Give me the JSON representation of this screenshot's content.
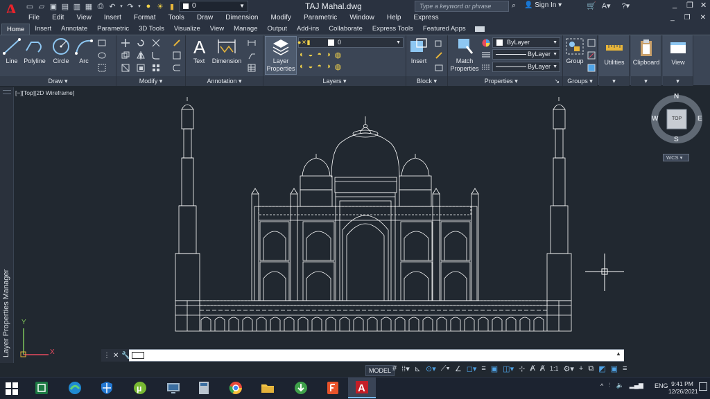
{
  "window": {
    "title": "TAJ Mahal.dwg",
    "search_placeholder": "Type a keyword or phrase",
    "sign_in": "Sign In",
    "qat_layer": "0",
    "controls": [
      "_",
      "❐",
      "✕"
    ]
  },
  "menubar": {
    "items": [
      "File",
      "Edit",
      "View",
      "Insert",
      "Format",
      "Tools",
      "Draw",
      "Dimension",
      "Modify",
      "Parametric",
      "Window",
      "Help",
      "Express"
    ]
  },
  "ribbon": {
    "tabs": [
      "Home",
      "Insert",
      "Annotate",
      "Parametric",
      "3D Tools",
      "Visualize",
      "View",
      "Manage",
      "Output",
      "Add-ins",
      "Collaborate",
      "Express Tools",
      "Featured Apps"
    ],
    "active_tab": "Home",
    "draw": {
      "title": "Draw",
      "line": "Line",
      "polyline": "Polyline",
      "circle": "Circle",
      "arc": "Arc"
    },
    "modify": {
      "title": "Modify"
    },
    "annotation": {
      "title": "Annotation",
      "text": "Text",
      "dimension": "Dimension"
    },
    "layers": {
      "title": "Layers",
      "layer_properties_1": "Layer",
      "layer_properties_2": "Properties",
      "current_layer": "0"
    },
    "block": {
      "title": "Block",
      "insert": "Insert"
    },
    "properties": {
      "title": "Properties",
      "match_1": "Match",
      "match_2": "Properties",
      "color": "ByLayer",
      "linetype": "ByLayer",
      "lineweight": "ByLayer"
    },
    "groups": {
      "title": "Groups",
      "group": "Group"
    },
    "utilities": {
      "title": "Utilities"
    },
    "clipboard": {
      "title": "Clipboard"
    },
    "view": {
      "title": "View"
    }
  },
  "drawing": {
    "viewport_label": "[−][Top][2D Wireframe]",
    "palette_title": "Layer Properties Manager",
    "viewcube": {
      "n": "N",
      "s": "S",
      "e": "E",
      "w": "W",
      "face": "TOP"
    },
    "wcs": "WCS",
    "ucs_x": "X",
    "ucs_y": "Y"
  },
  "command": {
    "value": "",
    "placeholder": ""
  },
  "status": {
    "model": "MODEL",
    "scale": "1:1"
  },
  "taskbar": {
    "language": "ENG",
    "time": "9:41 PM",
    "date": "12/26/2021"
  },
  "colors": {
    "background": "#212830",
    "ribbon": "#3b4555",
    "linework": "#ffffff",
    "autocad_red": "#e8232b",
    "accent_blue": "#4fa3e6"
  }
}
